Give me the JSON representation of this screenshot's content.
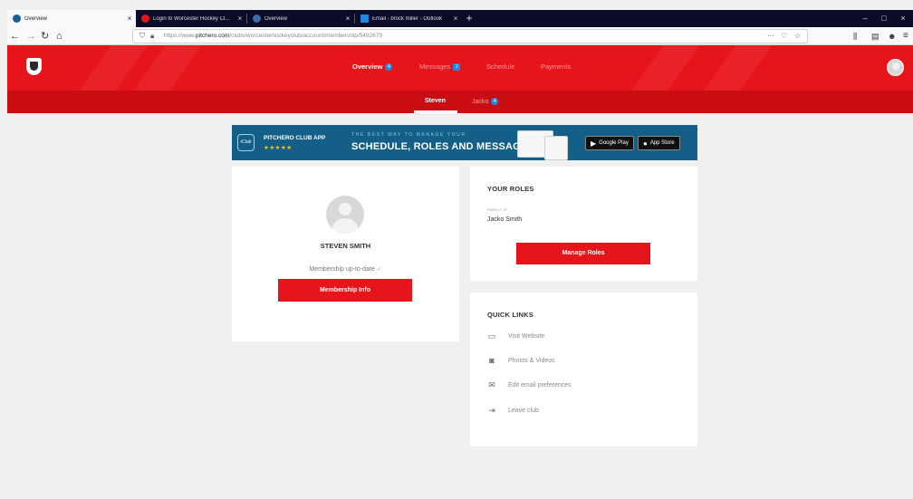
{
  "browser": {
    "tabs": [
      {
        "title": "Overview",
        "active": true,
        "favicon_color": "#1a5f9a"
      },
      {
        "title": "Login to Worcester Hockey Cl...",
        "active": false,
        "favicon_color": "#e8141b"
      },
      {
        "title": "Overview",
        "active": false,
        "favicon_color": "#3a6ea8"
      },
      {
        "title": "Email - brock miller - Outlook",
        "active": false,
        "favicon_color": "#1e88e5"
      }
    ],
    "new_tab": "+",
    "window_controls": [
      "–",
      "□",
      "×"
    ],
    "url": {
      "prefix": "https://www.",
      "domain": "pitchero.com",
      "path": "/clubs/worcesterhockeyclub/account/membership/5492679"
    },
    "nav_buttons": {
      "back": "←",
      "forward": "→",
      "reload": "↻",
      "home": "⌂"
    },
    "url_actions": {
      "more": "···",
      "star": "☆"
    },
    "toolbar_right": {
      "library": "⫼",
      "sidebar": "▤",
      "account": "☻",
      "menu": "≡"
    }
  },
  "header": {
    "nav": [
      {
        "label": "Overview",
        "badge": "4",
        "active": true
      },
      {
        "label": "Messages",
        "badge": "1",
        "active": false
      },
      {
        "label": "Schedule",
        "badge": "",
        "active": false
      },
      {
        "label": "Payments",
        "badge": "",
        "active": false
      }
    ],
    "subnav": [
      {
        "label": "Steven",
        "badge": "",
        "active": true
      },
      {
        "label": "Jacko",
        "badge": "4",
        "active": false
      }
    ]
  },
  "banner": {
    "app_icon_text": "rClub",
    "app_title": "PITCHERO CLUB APP",
    "stars": "★★★★★",
    "tagline": "THE BEST WAY TO MANAGE YOUR",
    "headline": "SCHEDULE, ROLES AND MESSAGES",
    "google_play": "Google Play",
    "app_store": "App Store"
  },
  "profile": {
    "name": "STEVEN SMITH",
    "membership_status": "Membership up-to-date",
    "check": "✓",
    "button": "Membership Info"
  },
  "roles": {
    "heading": "YOUR ROLES",
    "role_label": "PARENT OF",
    "person": "Jacko Smith",
    "button": "Manage Roles"
  },
  "quick_links": {
    "heading": "QUICK LINKS",
    "items": [
      {
        "label": "Visit Website",
        "icon": "browser-window-icon",
        "glyph": "▭"
      },
      {
        "label": "Photos & Videos",
        "icon": "camera-icon",
        "glyph": "◙"
      },
      {
        "label": "Edit email preferences",
        "icon": "envelope-icon",
        "glyph": "✉"
      },
      {
        "label": "Leave club",
        "icon": "exit-icon",
        "glyph": "⇥"
      }
    ]
  },
  "colors": {
    "brand_red": "#e8141b",
    "subnav_red": "#c90d13",
    "banner_blue": "#145f87",
    "badge_blue": "#1e88e5"
  }
}
